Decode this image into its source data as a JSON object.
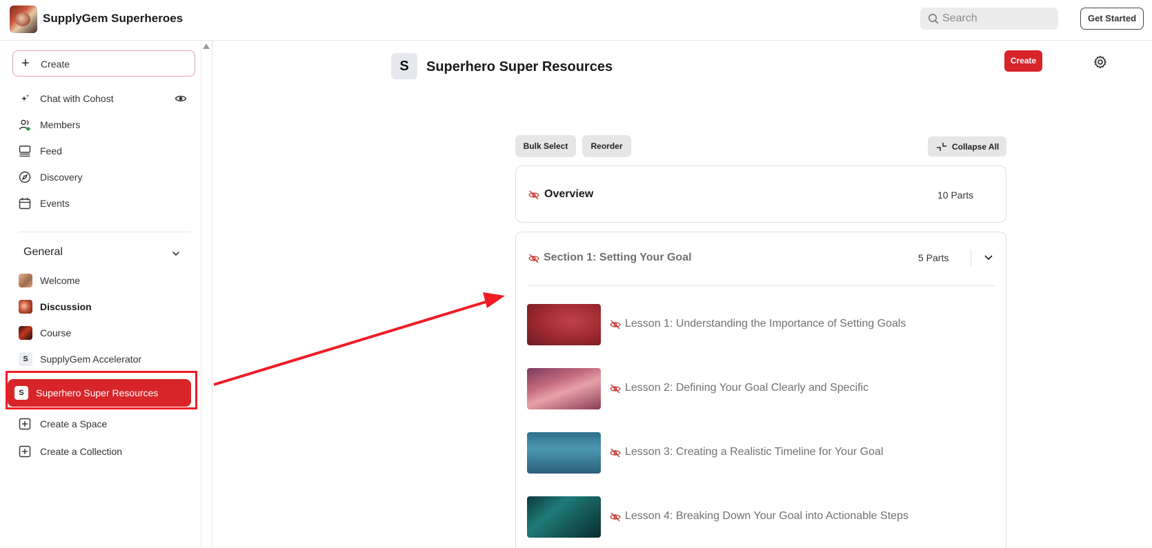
{
  "brand": {
    "name": "SupplyGem Superheroes"
  },
  "search": {
    "placeholder": "Search"
  },
  "topbar": {
    "get_started_label": "Get Started"
  },
  "sidebar": {
    "create_label": "Create",
    "nav": [
      {
        "label": "Chat with Cohost",
        "icon": "sparkle-icon"
      },
      {
        "label": "Members",
        "icon": "members-icon"
      },
      {
        "label": "Feed",
        "icon": "feed-icon"
      },
      {
        "label": "Discovery",
        "icon": "compass-icon"
      },
      {
        "label": "Events",
        "icon": "calendar-icon"
      }
    ],
    "section_title": "General",
    "spaces": [
      {
        "label": "Welcome"
      },
      {
        "label": "Discussion"
      },
      {
        "label": "Course"
      },
      {
        "label": "SupplyGem Accelerator",
        "badge": "S"
      },
      {
        "label": "Superhero Super Resources",
        "badge": "S",
        "active": true
      }
    ],
    "actions": [
      {
        "label": "Create a Space"
      },
      {
        "label": "Create a Collection"
      }
    ]
  },
  "main": {
    "space_badge": "S",
    "space_title": "Superhero Super Resources",
    "create_label": "Create",
    "bulk_select_label": "Bulk Select",
    "reorder_label": "Reorder",
    "collapse_all_label": "Collapse All",
    "overview": {
      "title": "Overview",
      "parts": "10 Parts"
    },
    "section": {
      "title": "Section 1: Setting Your Goal",
      "parts": "5 Parts",
      "lessons": [
        {
          "title": "Lesson 1: Understanding the Importance of Setting Goals"
        },
        {
          "title": "Lesson 2: Defining Your Goal Clearly and Specific"
        },
        {
          "title": "Lesson 3: Creating a Realistic Timeline for Your Goal"
        },
        {
          "title": "Lesson 4: Breaking Down Your Goal into Actionable Steps"
        }
      ]
    }
  },
  "colors": {
    "accent": "#d8252a",
    "annotation": "#ef1c25"
  }
}
